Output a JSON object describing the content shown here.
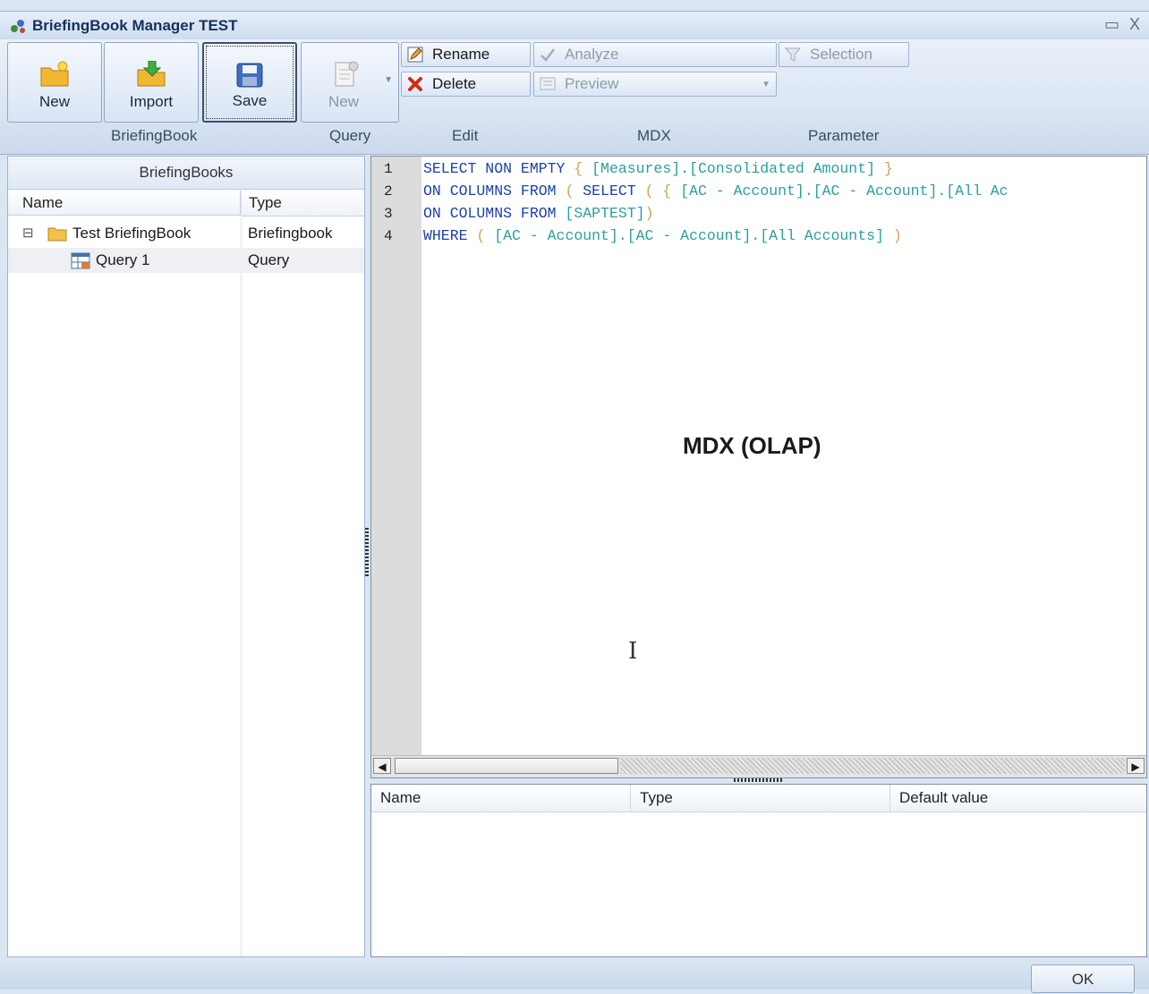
{
  "window": {
    "title": "BriefingBook Manager TEST",
    "restore_glyph": "▭",
    "close_glyph": "X"
  },
  "ribbon": {
    "briefingbook_group": {
      "caption": "BriefingBook",
      "new_label": "New",
      "import_label": "Import",
      "save_label": "Save"
    },
    "query_group": {
      "caption": "Query",
      "new_label": "New"
    },
    "edit_group": {
      "caption": "Edit",
      "rename_label": "Rename",
      "delete_label": "Delete"
    },
    "mdx_group": {
      "caption": "MDX",
      "analyze_label": "Analyze",
      "preview_label": "Preview"
    },
    "parameter_group": {
      "caption": "Parameter",
      "selection_label": "Selection"
    }
  },
  "left_panel": {
    "header": "BriefingBooks",
    "columns": [
      "Name",
      "Type"
    ],
    "rows": [
      {
        "name": "Test BriefingBook",
        "type": "Briefingbook",
        "expander": "⊟"
      },
      {
        "name": "Query 1",
        "type": "Query"
      }
    ]
  },
  "editor": {
    "line_numbers": [
      "1",
      "2",
      "3",
      "4"
    ],
    "watermark": "MDX (OLAP)",
    "cursor_glyph": "I"
  },
  "params_grid": {
    "columns": [
      "Name",
      "Type",
      "Default value"
    ]
  },
  "footer": {
    "ok_label": "OK"
  },
  "colors": {
    "keyword": "#1a3fb3",
    "identifier": "#2aa0a0",
    "bracket": "#d6a24a",
    "ribbon_bg": "#dbe6f4"
  }
}
